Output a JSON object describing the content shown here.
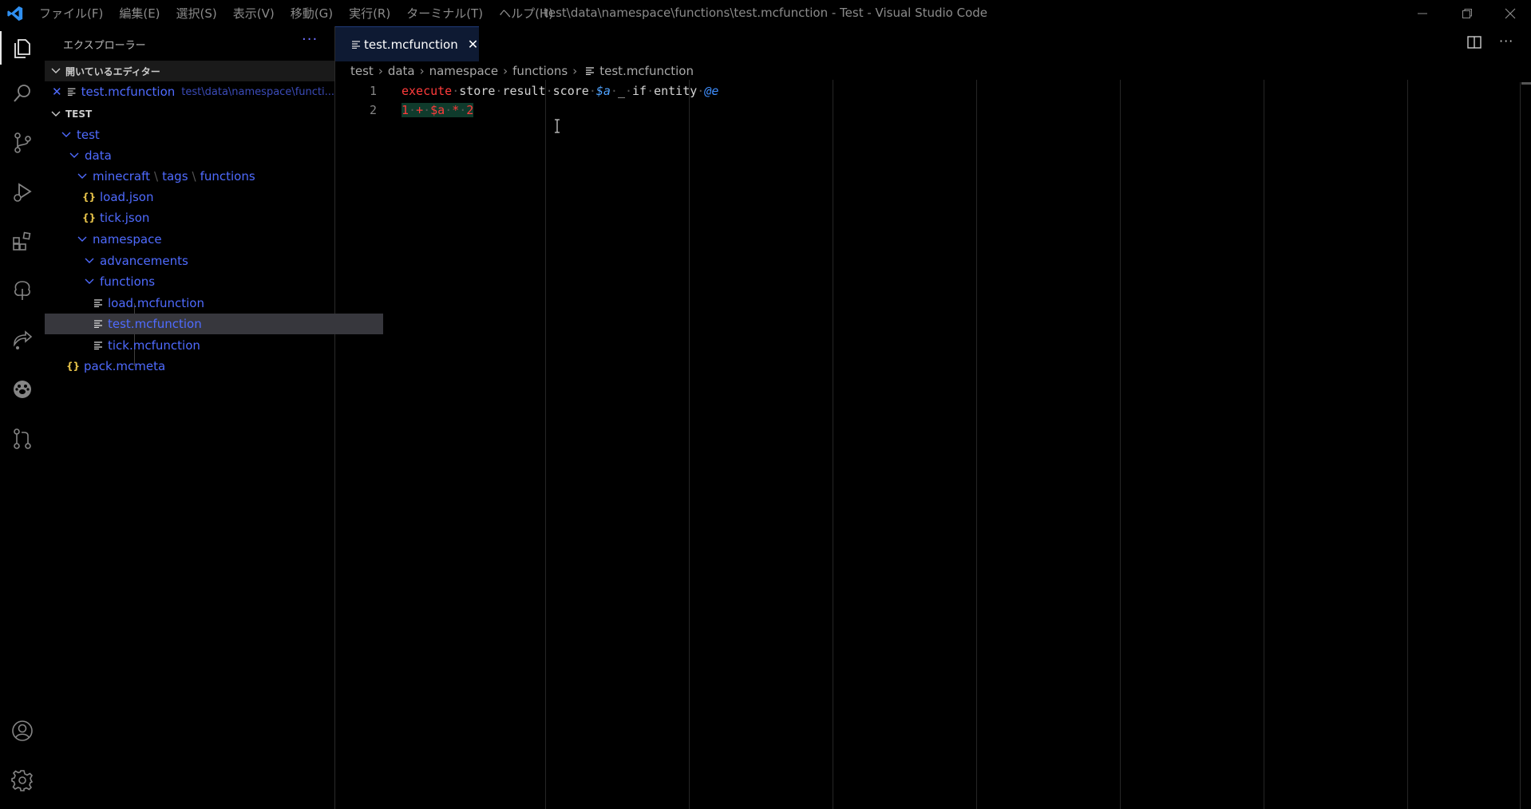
{
  "window": {
    "title": "test\\data\\namespace\\functions\\test.mcfunction - Test - Visual Studio Code",
    "menu": [
      "ファイル(F)",
      "編集(E)",
      "選択(S)",
      "表示(V)",
      "移動(G)",
      "実行(R)",
      "ターミナル(T)",
      "ヘルプ(H)"
    ],
    "controls": [
      "minimize-icon",
      "restore-icon",
      "close-icon"
    ]
  },
  "activity_bar": [
    "explorer-icon",
    "search-icon",
    "source-control-icon",
    "run-debug-icon",
    "extensions-icon",
    "tree-icon",
    "remote-icon",
    "paw-icon",
    "pull-request-icon",
    "account-icon",
    "settings-gear-icon"
  ],
  "sidebar": {
    "title": "エクスプローラー",
    "more": "···",
    "open_editors": {
      "header": "開いているエディター",
      "items": [
        {
          "name": "test.mcfunction",
          "path": "test\\data\\namespace\\functi..."
        }
      ]
    },
    "project": {
      "header": "TEST",
      "tree": {
        "test": "test",
        "data": "data",
        "tags_path": [
          "minecraft",
          "tags",
          "functions"
        ],
        "load_json": "load.json",
        "tick_json": "tick.json",
        "namespace": "namespace",
        "advancements": "advancements",
        "functions": "functions",
        "load_mcfunction": "load.mcfunction",
        "test_mcfunction": "test.mcfunction",
        "tick_mcfunction": "tick.mcfunction",
        "pack_mcmeta": "pack.mcmeta"
      }
    }
  },
  "editor": {
    "tab": {
      "label": "test.mcfunction",
      "close": "✕"
    },
    "breadcrumb": [
      "test",
      "data",
      "namespace",
      "functions",
      "test.mcfunction"
    ],
    "line_numbers": [
      "1",
      "2"
    ],
    "line1": {
      "execute": "execute",
      "store": "store",
      "result": "result",
      "score": "score",
      "var": "$a",
      "underscore": "_",
      "if": "if",
      "entity": "entity",
      "selector": "@e"
    },
    "line2": {
      "one": "1",
      "plus": "+",
      "var": "$a",
      "times": "*",
      "two": "2"
    }
  },
  "colors": {
    "accent": "#4f6bff",
    "keyword": "#ff3b3b",
    "variable": "#4fa3ff",
    "json_icon": "#e8c44a"
  }
}
